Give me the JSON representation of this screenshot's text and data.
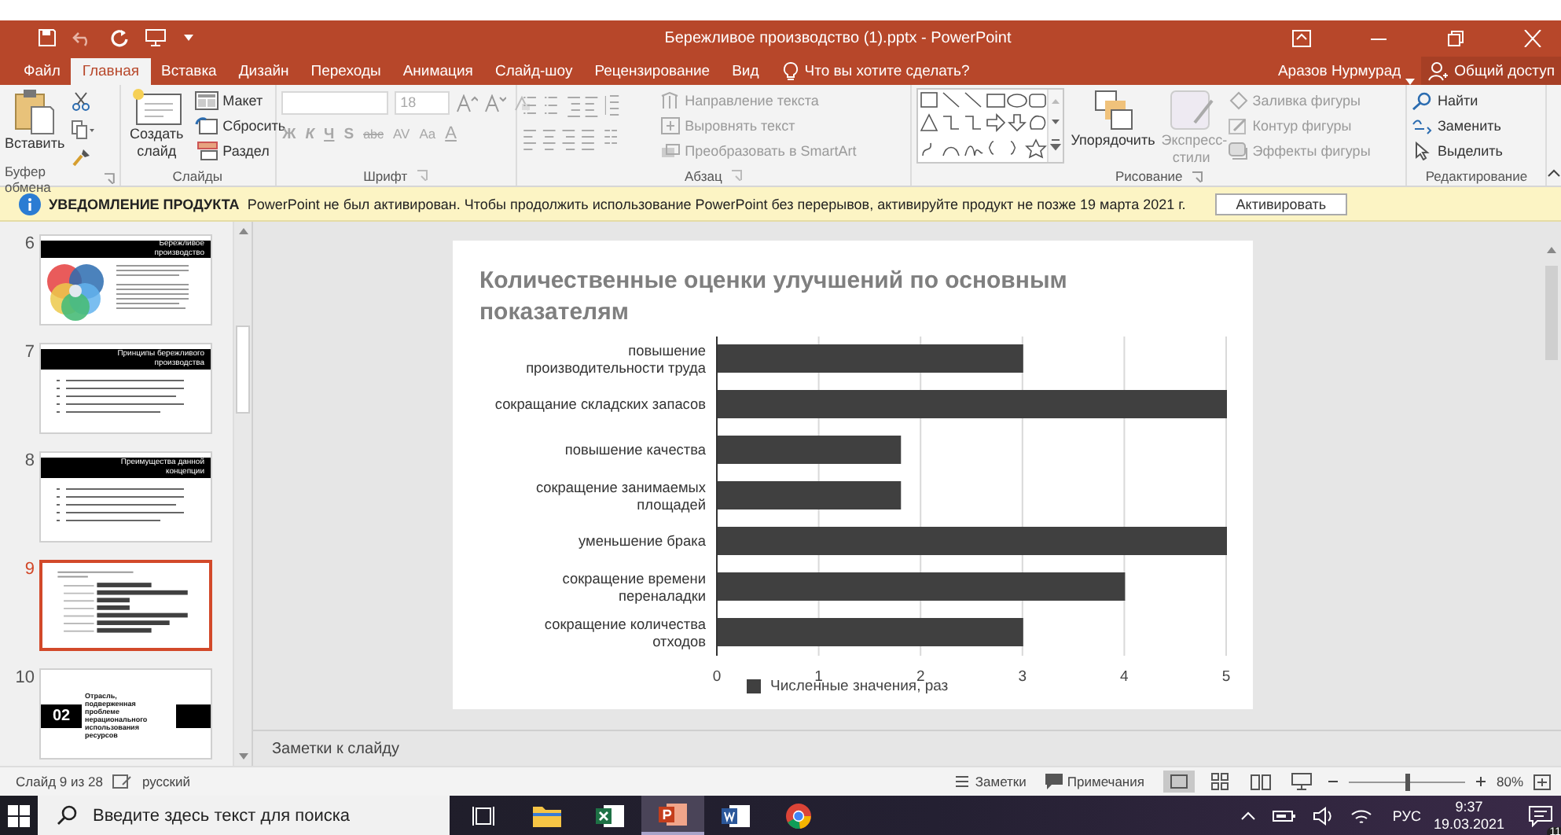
{
  "window": {
    "title": "Бережливое производство (1).pptx - PowerPoint"
  },
  "tabs": [
    {
      "label": "Файл",
      "selected": false
    },
    {
      "label": "Главная",
      "selected": true
    },
    {
      "label": "Вставка",
      "selected": false
    },
    {
      "label": "Дизайн",
      "selected": false
    },
    {
      "label": "Переходы",
      "selected": false
    },
    {
      "label": "Анимация",
      "selected": false
    },
    {
      "label": "Слайд-шоу",
      "selected": false
    },
    {
      "label": "Рецензирование",
      "selected": false
    },
    {
      "label": "Вид",
      "selected": false
    }
  ],
  "tell_me": {
    "placeholder": "Что вы хотите сделать?"
  },
  "account": {
    "user": "Аразов Нурмурад",
    "share": "Общий доступ"
  },
  "ribbon": {
    "clipboard": {
      "label": "Буфер обмена",
      "paste": "Вставить"
    },
    "slides": {
      "label": "Слайды",
      "new_slide": "Создать слайд",
      "commands": [
        {
          "label": "Макет",
          "kind": "layout"
        },
        {
          "label": "Сбросить",
          "kind": "reset"
        },
        {
          "label": "Раздел",
          "kind": "section"
        }
      ]
    },
    "font": {
      "label": "Шрифт",
      "disabled": true,
      "size": "18",
      "format_buttons": [
        "Ж",
        "К",
        "Ч",
        "S",
        "abc",
        "AV",
        "Aa",
        "A"
      ]
    },
    "paragraph": {
      "label": "Абзац",
      "commands": [
        {
          "label": "Направление текста",
          "kind": "direction",
          "disabled": true
        },
        {
          "label": "Выровнять текст",
          "kind": "align",
          "disabled": true
        },
        {
          "label": "Преобразовать в SmartArt",
          "kind": "smartart",
          "disabled": true
        }
      ]
    },
    "drawing": {
      "label": "Рисование",
      "arrange": "Упорядочить",
      "quick_styles": {
        "label": "Экспресс-стили",
        "disabled": true
      },
      "commands": [
        {
          "label": "Заливка фигуры",
          "kind": "fill",
          "disabled": true
        },
        {
          "label": "Контур фигуры",
          "kind": "outline",
          "disabled": true
        },
        {
          "label": "Эффекты фигуры",
          "kind": "effects",
          "disabled": true
        }
      ]
    },
    "editing": {
      "label": "Редактирование",
      "commands": [
        {
          "label": "Найти",
          "kind": "find"
        },
        {
          "label": "Заменить",
          "kind": "replace"
        },
        {
          "label": "Выделить",
          "kind": "select"
        }
      ]
    }
  },
  "notice": {
    "label": "УВЕДОМЛЕНИЕ ПРОДУКТА",
    "message": "PowerPoint не был активирован. Чтобы продолжить использование PowerPoint без перерывов, активируйте продукт не позже 19 марта 2021 г.",
    "button": "Активировать"
  },
  "thumbnails": [
    {
      "number": "6",
      "selected": false,
      "kind": "venn",
      "title": "Бережливое производство"
    },
    {
      "number": "7",
      "selected": false,
      "kind": "bullets",
      "title": "Принципы бережливого производства"
    },
    {
      "number": "8",
      "selected": false,
      "kind": "bullets",
      "title": "Преимущества данной концепции"
    },
    {
      "number": "9",
      "selected": true,
      "kind": "chart"
    },
    {
      "number": "10",
      "selected": false,
      "kind": "section",
      "title": "02",
      "subtitle": "Отрасль, подверженная проблеме нерационального использования ресурсов"
    }
  ],
  "slide": {
    "chart_data": {
      "type": "bar",
      "orientation": "horizontal",
      "title": "Количественные оценки улучшений по основным показателям",
      "categories": [
        "повышение\nпроизводительности труда",
        "сокращание складских запасов",
        "повышение качества",
        "сокращение занимаемых\nплощадей",
        "уменьшение брака",
        "сокращение времени\nпереналадки",
        "сокращение количества\nотходов"
      ],
      "series": [
        {
          "name": "Численные значения, раз",
          "color": "#404040",
          "values": [
            3,
            5,
            1.8,
            1.8,
            5,
            4,
            3
          ]
        }
      ],
      "xlim": [
        0,
        5
      ],
      "xticks": [
        0,
        1,
        2,
        3,
        4,
        5
      ],
      "grid": true
    }
  },
  "notes_bar": {
    "label": "Заметки к слайду"
  },
  "status_bar": {
    "slide": "Слайд 9 из 28",
    "language": "русский",
    "notes": "Заметки",
    "comments": "Примечания",
    "zoom": "80%",
    "zoom_slider": {
      "level": 0.5
    }
  },
  "taskbar": {
    "search": {
      "placeholder": "Введите здесь текст для поиска"
    },
    "apps": [
      {
        "kind": "task_view",
        "active": false
      },
      {
        "kind": "folder",
        "active": false
      },
      {
        "kind": "excel",
        "active": false
      },
      {
        "kind": "powerpoint",
        "active": true
      },
      {
        "kind": "word",
        "active": false
      },
      {
        "kind": "browser",
        "active": false
      }
    ],
    "language": "РУС",
    "time": "9:37",
    "date": "19.03.2021",
    "notifications": "11"
  }
}
